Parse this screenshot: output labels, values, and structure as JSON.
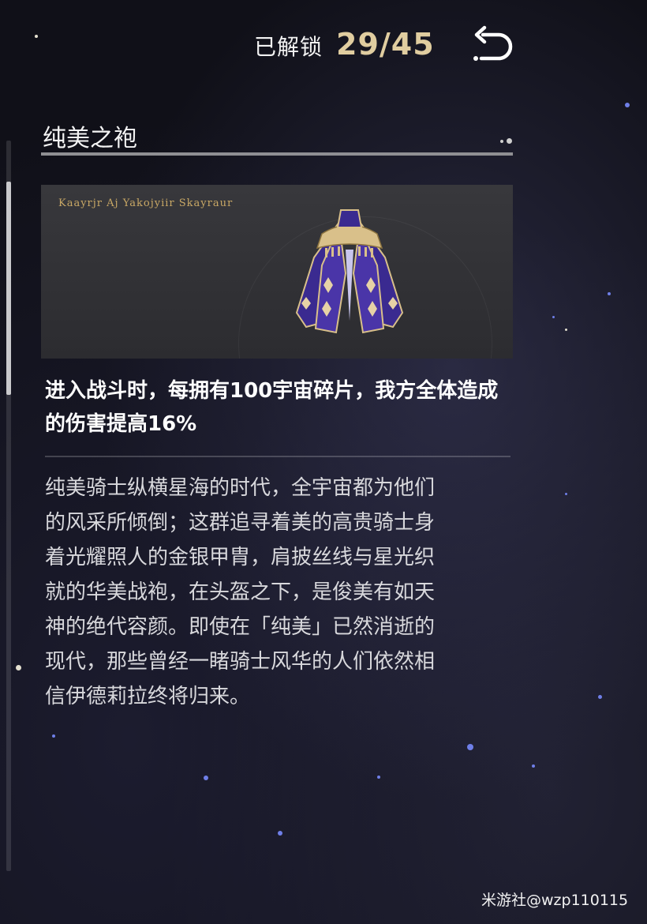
{
  "header": {
    "unlock_label": "已解锁",
    "unlock_count": "29/45"
  },
  "item": {
    "title": "纯美之袍",
    "banner_script": "Kaayrjr Aj Yakojyiir Skayraur",
    "effect": "进入战斗时，每拥有100宇宙碎片，我方全体造成的伤害提高16%",
    "lore": "纯美骑士纵横星海的时代，全宇宙都为他们\n的风采所倾倒；这群追寻着美的高贵骑士身\n着光耀照人的金银甲胄，肩披丝线与星光织\n就的华美战袍，在头盔之下，是俊美有如天\n神的绝代容颜。即使在「纯美」已然消逝的\n现代，那些曾经一睹骑士风华的人们依然相\n信伊德莉拉终将归来。"
  },
  "icons": {
    "back": "back-arrow-icon",
    "cloak": "cloak-icon"
  },
  "watermark": "米游社@wzp110115",
  "colors": {
    "accent_gold": "#e0cda0",
    "cloak_purple": "#4a35a8",
    "cloak_gold": "#d9c08a"
  }
}
